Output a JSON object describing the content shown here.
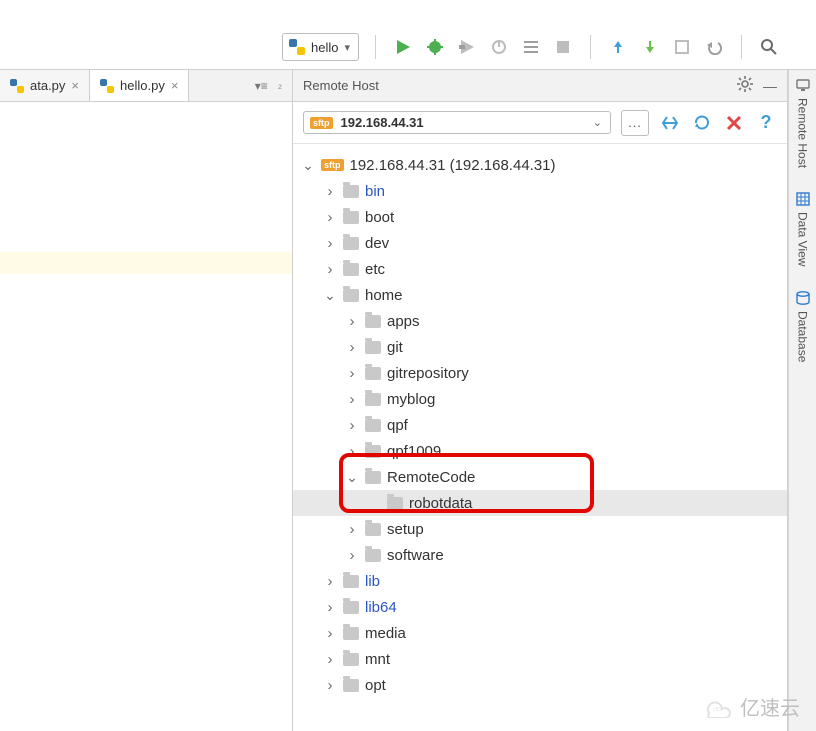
{
  "toolbar": {
    "run_config_label": "hello"
  },
  "tabs": [
    {
      "label": "ata.py",
      "active": false
    },
    {
      "label": "hello.py",
      "active": true
    }
  ],
  "remote_panel": {
    "title": "Remote Host",
    "host_selected": "192.168.44.31",
    "more_btn": "...",
    "help_btn": "?"
  },
  "side_labels": {
    "remote_host": "Remote Host",
    "data_view": "Data View",
    "database": "Database"
  },
  "tree": [
    {
      "lvl": 0,
      "arrow": "down",
      "icon": "sftp",
      "label": "192.168.44.31 (192.168.44.31)"
    },
    {
      "lvl": 1,
      "arrow": "right",
      "icon": "folder",
      "label": "bin",
      "link": true
    },
    {
      "lvl": 1,
      "arrow": "right",
      "icon": "folder",
      "label": "boot"
    },
    {
      "lvl": 1,
      "arrow": "right",
      "icon": "folder",
      "label": "dev"
    },
    {
      "lvl": 1,
      "arrow": "right",
      "icon": "folder",
      "label": "etc"
    },
    {
      "lvl": 1,
      "arrow": "down",
      "icon": "folder",
      "label": "home"
    },
    {
      "lvl": 2,
      "arrow": "right",
      "icon": "folder",
      "label": "apps"
    },
    {
      "lvl": 2,
      "arrow": "right",
      "icon": "folder",
      "label": "git"
    },
    {
      "lvl": 2,
      "arrow": "right",
      "icon": "folder",
      "label": "gitrepository"
    },
    {
      "lvl": 2,
      "arrow": "right",
      "icon": "folder",
      "label": "myblog"
    },
    {
      "lvl": 2,
      "arrow": "right",
      "icon": "folder",
      "label": "qpf"
    },
    {
      "lvl": 2,
      "arrow": "right",
      "icon": "folder",
      "label": "qpf1009"
    },
    {
      "lvl": 2,
      "arrow": "down",
      "icon": "folder",
      "label": "RemoteCode"
    },
    {
      "lvl": 3,
      "arrow": "none",
      "icon": "folder",
      "label": "robotdata",
      "sel": true
    },
    {
      "lvl": 2,
      "arrow": "right",
      "icon": "folder",
      "label": "setup"
    },
    {
      "lvl": 2,
      "arrow": "right",
      "icon": "folder",
      "label": "software"
    },
    {
      "lvl": 1,
      "arrow": "right",
      "icon": "folder",
      "label": "lib",
      "link": true
    },
    {
      "lvl": 1,
      "arrow": "right",
      "icon": "folder",
      "label": "lib64",
      "link": true
    },
    {
      "lvl": 1,
      "arrow": "right",
      "icon": "folder",
      "label": "media"
    },
    {
      "lvl": 1,
      "arrow": "right",
      "icon": "folder",
      "label": "mnt"
    },
    {
      "lvl": 1,
      "arrow": "right",
      "icon": "folder",
      "label": "opt"
    }
  ],
  "watermark": "亿速云"
}
